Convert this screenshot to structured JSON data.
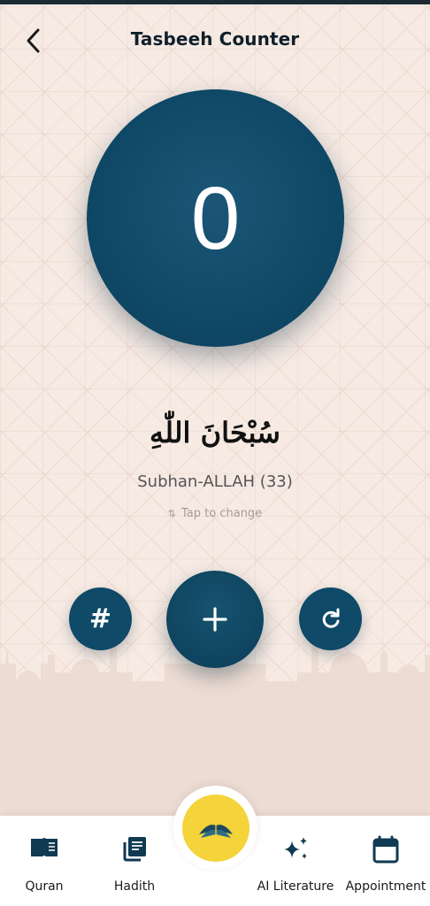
{
  "header": {
    "title": "Tasbeeh Counter"
  },
  "counter": {
    "value": "0"
  },
  "dhikr": {
    "arabic": "سُبْحَانَ اللّٰهِ",
    "transliteration": "Subhan-ALLAH (33)",
    "tap_hint": "Tap to change"
  },
  "controls": {
    "count_icon_glyph": "#"
  },
  "icons": {
    "back": "chevron-left-icon",
    "swap": "swap-vertical-icon",
    "hash": "hash-icon",
    "add": "plus-icon",
    "reset": "refresh-icon",
    "quran": "open-book-icon",
    "hadith": "document-stack-icon",
    "center": "quran-stand-icon",
    "ai": "sparkles-icon",
    "appointment": "calendar-icon"
  },
  "colors": {
    "primary": "#0f4a68",
    "accent": "#f4d43a",
    "background": "#f5e9e2"
  },
  "bottom_nav": {
    "items": [
      {
        "label": "Quran"
      },
      {
        "label": "Hadith"
      },
      {
        "label": "AI Literature"
      },
      {
        "label": "Appointment"
      }
    ]
  }
}
